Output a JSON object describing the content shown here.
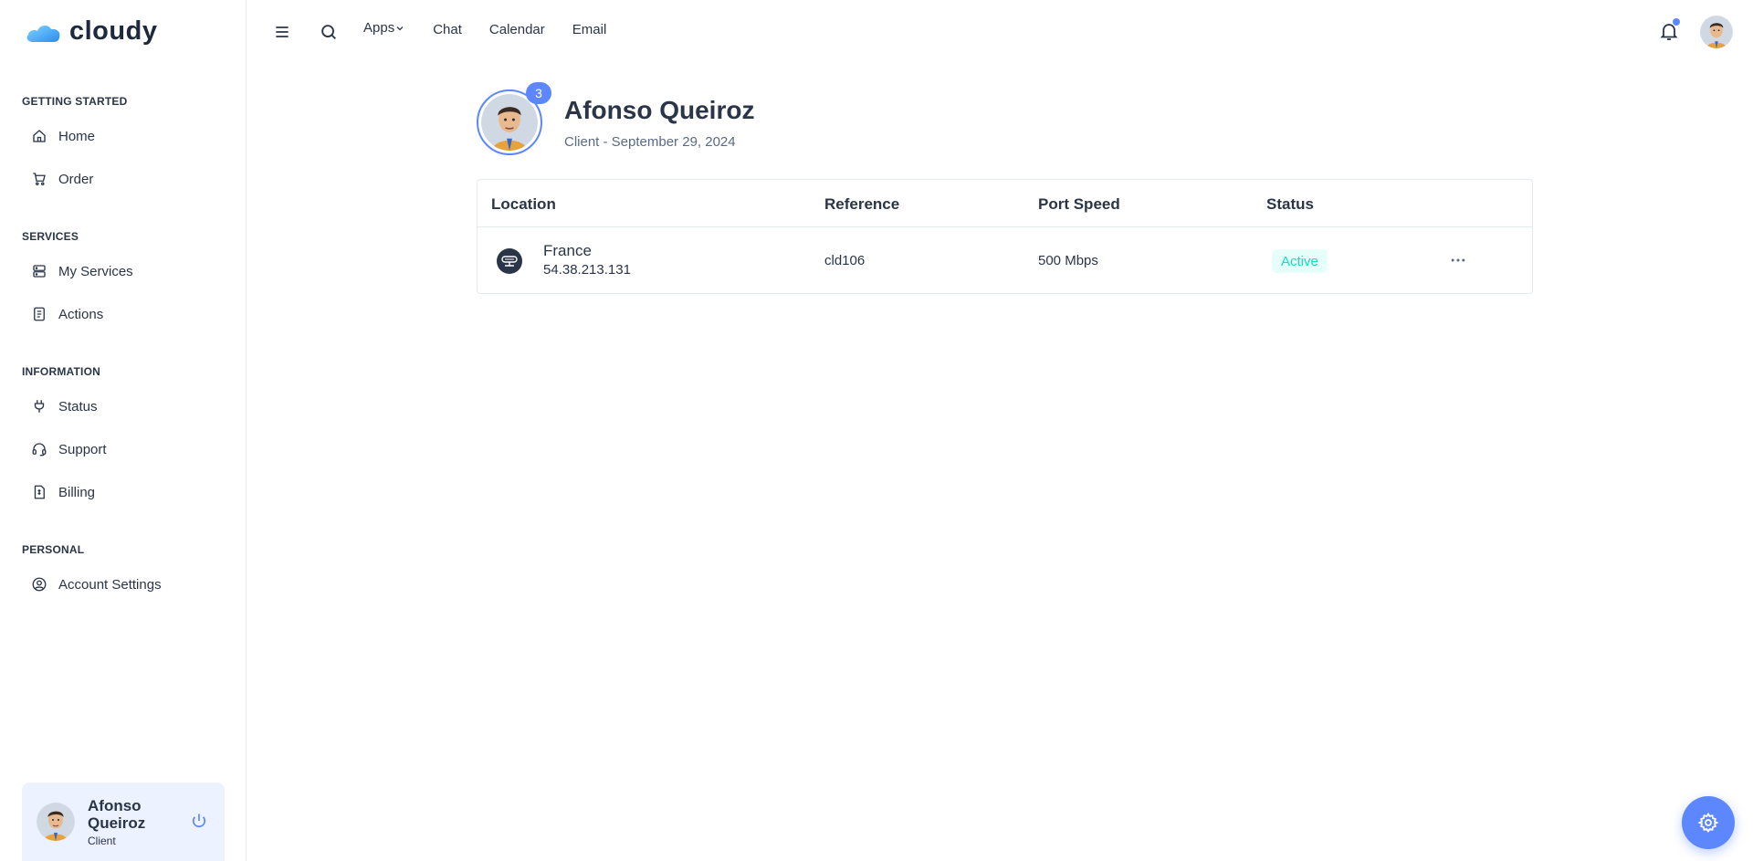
{
  "brand": {
    "name": "cloudy"
  },
  "sidebar": {
    "sections": [
      {
        "title": "GETTING STARTED",
        "items": [
          {
            "label": "Home",
            "icon": "home-icon"
          },
          {
            "label": "Order",
            "icon": "cart-icon"
          }
        ]
      },
      {
        "title": "SERVICES",
        "items": [
          {
            "label": "My Services",
            "icon": "server-icon"
          },
          {
            "label": "Actions",
            "icon": "clipboard-icon"
          }
        ]
      },
      {
        "title": "INFORMATION",
        "items": [
          {
            "label": "Status",
            "icon": "plug-icon"
          },
          {
            "label": "Support",
            "icon": "headset-icon"
          },
          {
            "label": "Billing",
            "icon": "receipt-icon"
          }
        ]
      },
      {
        "title": "PERSONAL",
        "items": [
          {
            "label": "Account Settings",
            "icon": "user-circle-icon"
          }
        ]
      }
    ],
    "user": {
      "name": "Afonso Queiroz",
      "role": "Client"
    }
  },
  "header": {
    "nav": [
      "Apps",
      "Chat",
      "Calendar",
      "Email"
    ],
    "notification_dot_color": "#5d87ff"
  },
  "profile": {
    "name": "Afonso Queiroz",
    "subtitle": "Client - September 29, 2024",
    "badge_count": "3"
  },
  "table": {
    "columns": [
      "Location",
      "Reference",
      "Port Speed",
      "Status"
    ],
    "rows": [
      {
        "location": "France",
        "ip": "54.38.213.131",
        "reference": "cld106",
        "port_speed": "500 Mbps",
        "status": "Active"
      }
    ]
  },
  "colors": {
    "primary": "#5d87ff",
    "success": "#13deb9",
    "success_bg": "#e6fffa",
    "text": "#2a3547"
  }
}
